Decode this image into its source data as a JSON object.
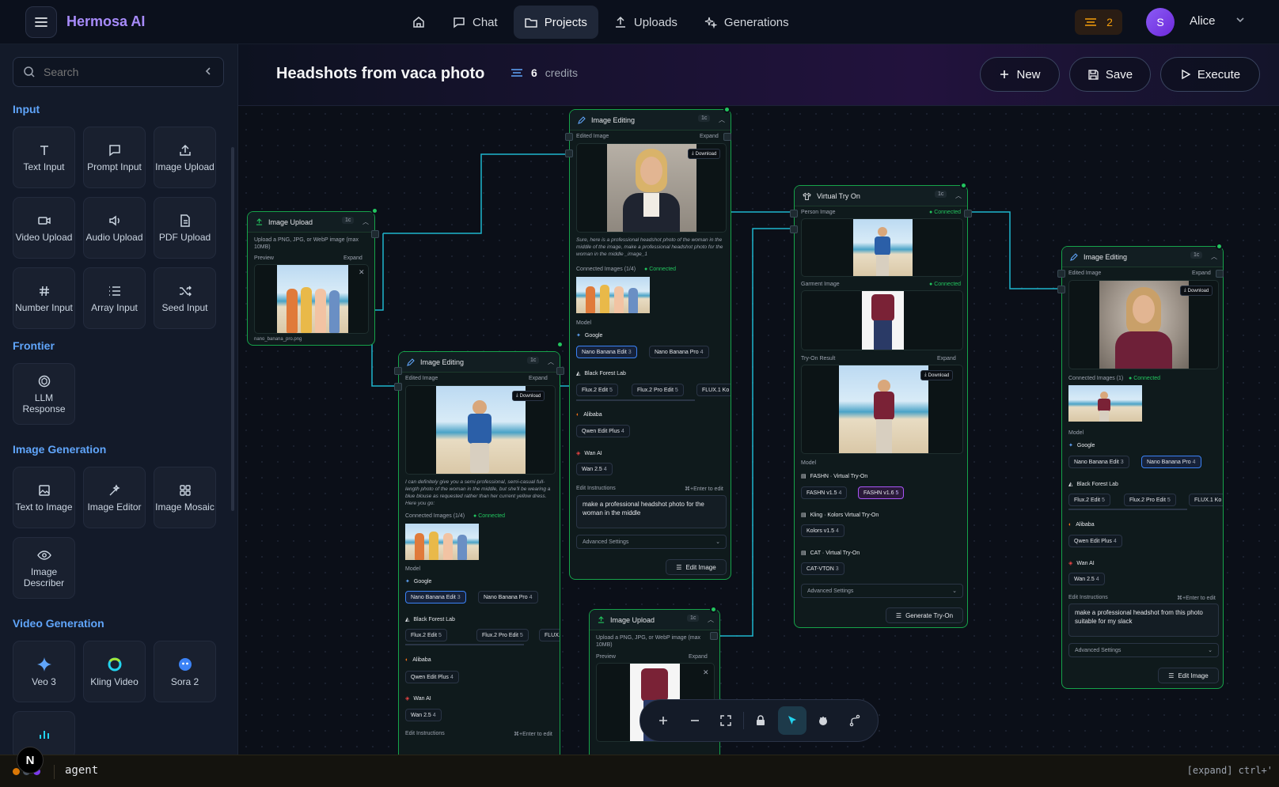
{
  "app": {
    "name": "Hermosa AI",
    "notifications": "2",
    "user_initial": "S",
    "user_name": "Alice"
  },
  "nav": [
    {
      "label": ""
    },
    {
      "label": "Chat"
    },
    {
      "label": "Projects"
    },
    {
      "label": "Uploads"
    },
    {
      "label": "Generations"
    }
  ],
  "sidebar": {
    "search_placeholder": "Search",
    "sections": [
      {
        "title": "Input",
        "items": [
          "Text Input",
          "Prompt Input",
          "Image Upload",
          "Video Upload",
          "Audio Upload",
          "PDF Upload",
          "Number Input",
          "Array Input",
          "Seed Input"
        ]
      },
      {
        "title": "Frontier",
        "items": [
          "LLM Response"
        ]
      },
      {
        "title": "Image Generation",
        "items": [
          "Text to Image",
          "Image Editor",
          "Image Mosaic",
          "Image Describer"
        ]
      },
      {
        "title": "Video Generation",
        "items": [
          "Veo 3",
          "Kling Video",
          "Sora 2"
        ]
      }
    ]
  },
  "project": {
    "title": "Headshots from vaca photo",
    "credits_value": "6",
    "credits_label": "credits",
    "new_label": "New",
    "save_label": "Save",
    "execute_label": "Execute"
  },
  "common": {
    "tag": "1c",
    "expand": "Expand",
    "download": "Download",
    "preview": "Preview",
    "edited_image": "Edited Image",
    "connected": "Connected",
    "model": "Model",
    "edit_instructions": "Edit Instructions",
    "enter_hint": "⌘+Enter to edit",
    "advanced": "Advanced Settings",
    "edit_image": "Edit Image",
    "upload_hint": "Upload a PNG, JPG, or WebP image (max 10MB)",
    "google": "Google",
    "bfl": "Black Forest Lab",
    "alibaba": "Alibaba",
    "wan": "Wan AI",
    "nano_edit": "Nano Banana Edit",
    "nano_pro": "Nano Banana Pro",
    "flux2_edit": "Flux.2 Edit",
    "flux2_pro": "Flux.2 Pro Edit",
    "flux1": "FLUX.1 Ko",
    "qwen": "Qwen Edit Plus",
    "wan25": "Wan 2.5",
    "cost3": "3",
    "cost4": "4",
    "cost5": "5"
  },
  "nodes": {
    "upload1": {
      "title": "Image Upload",
      "filename": "nano_banana_pro.png"
    },
    "edit1": {
      "title": "Image Editing",
      "caption": "I can definitely give you a semi-professional, semi-casual full-length photo of the woman in the middle, but she'll be wearing a blue blouse as requested rather than her current yellow dress. Here you go:",
      "connected_label": "Connected Images (1/4)"
    },
    "edit2": {
      "title": "Image Editing",
      "caption": "Sure, here is a professional headshot photo of the woman in the middle of the image, make a professional headshot photo for the woman in the middle _image_1",
      "connected_label": "Connected Images (1/4)",
      "instruction": "make a professional headshot photo for the woman in the middle"
    },
    "upload2": {
      "title": "Image Upload"
    },
    "tryon": {
      "title": "Virtual Try On",
      "person": "Person Image",
      "garment": "Garment Image",
      "result": "Try-On Result",
      "fashn": "FASHN · Virtual Try-On",
      "fashn15": "FASHN v1.5",
      "fashn16": "FASHN v1.6",
      "kling": "Kling · Kolors Virtual Try-On",
      "kolors": "Kolors v1.5",
      "cat": "CAT · Virtual Try-On",
      "catvton": "CAT-VTON",
      "generate": "Generate Try-On"
    },
    "edit3": {
      "title": "Image Editing",
      "connected_label": "Connected Images (1)",
      "instruction": "make a professional headshot from this photo suitable for my slack"
    }
  },
  "status": {
    "agent": "agent",
    "hint": "[expand] ctrl+'"
  },
  "colors": {
    "accent": "#60a5fa",
    "brand": "#a78bfa",
    "node_border": "#16a34a",
    "wire": "#22d3ee",
    "credits": "#f59e0b"
  }
}
